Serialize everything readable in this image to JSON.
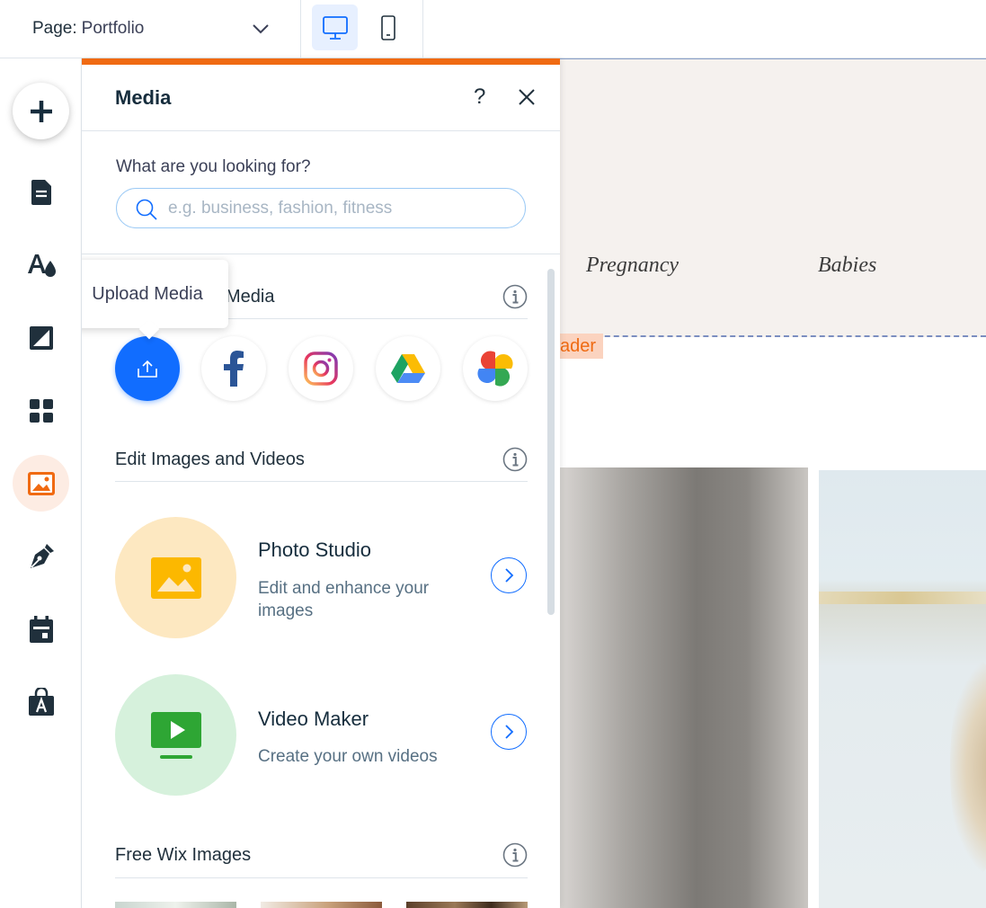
{
  "topbar": {
    "page_prefix": "Page:",
    "page_name": "Portfolio",
    "devices": [
      "desktop-icon",
      "mobile-icon"
    ]
  },
  "rail": {
    "items": [
      "add-icon",
      "pages-icon",
      "theme-icon",
      "background-icon",
      "apps-icon",
      "media-icon",
      "blog-icon",
      "bookings-icon",
      "store-icon"
    ],
    "active": "media-icon"
  },
  "canvas": {
    "nav": [
      "Pregnancy",
      "Babies"
    ],
    "header_tag": "ader"
  },
  "panel": {
    "title": "Media",
    "help_label": "?",
    "search": {
      "label": "What are you looking for?",
      "placeholder": "e.g. business, fashion, fitness"
    },
    "upload_section_title": "Media",
    "tooltip": "Upload Media",
    "sources": [
      "upload-icon",
      "facebook-icon",
      "instagram-icon",
      "google-drive-icon",
      "google-photos-icon"
    ],
    "edit_section_title": "Edit Images and Videos",
    "tools": [
      {
        "title": "Photo Studio",
        "desc": "Edit and enhance your images"
      },
      {
        "title": "Video Maker",
        "desc": "Create your own videos"
      }
    ],
    "free_section_title": "Free Wix Images"
  },
  "colors": {
    "accent": "#116dff",
    "brand_orange": "#f06a12"
  }
}
